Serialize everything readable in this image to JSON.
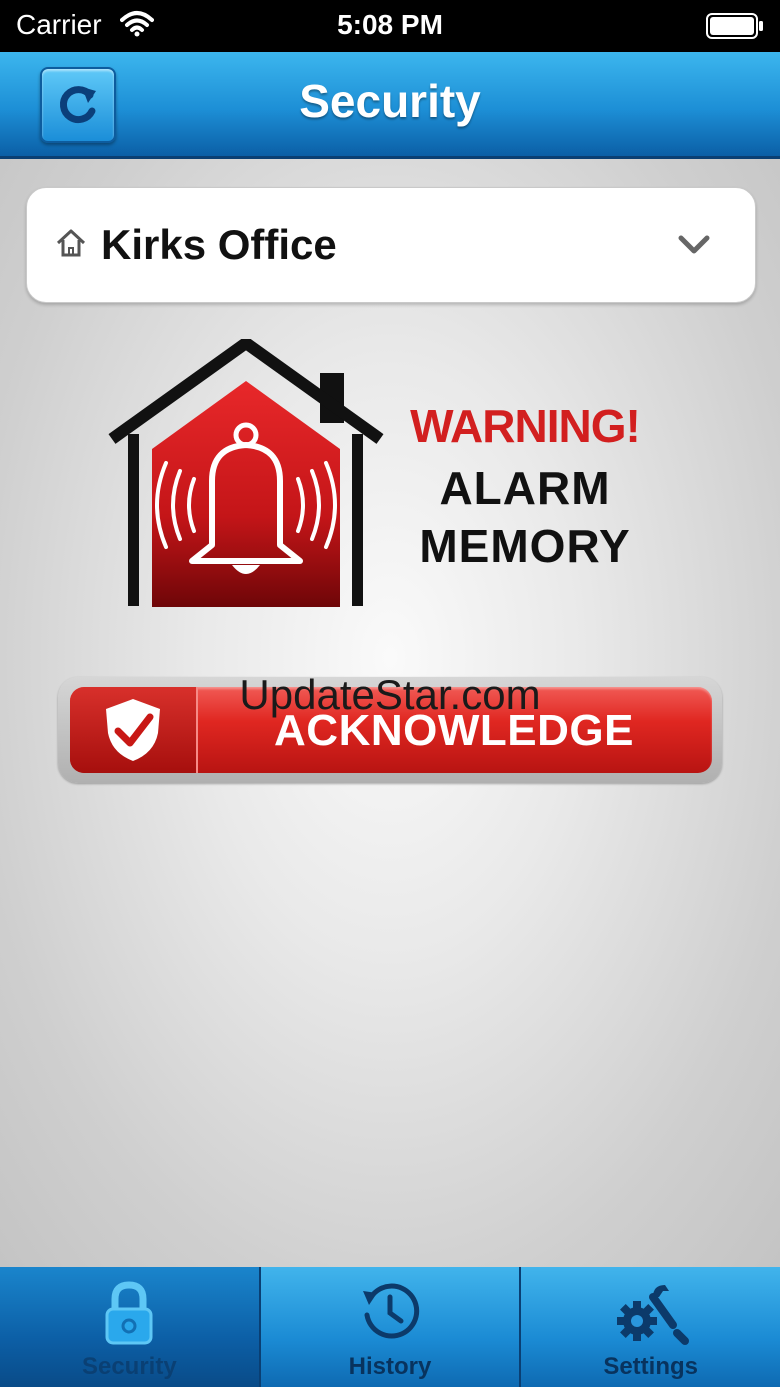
{
  "status_bar": {
    "carrier": "Carrier",
    "time": "5:08 PM"
  },
  "nav": {
    "title": "Security",
    "refresh_icon": "refresh-icon"
  },
  "location": {
    "name": "Kirks Office",
    "icon": "home-icon",
    "dropdown_icon": "chevron-down-icon"
  },
  "alert": {
    "warning": "WARNING!",
    "line1": "ALARM",
    "line2": "MEMORY",
    "icon": "alarm-bell-house-icon",
    "warning_color": "#d21f1f"
  },
  "acknowledge": {
    "label": "ACKNOWLEDGE",
    "icon": "shield-check-icon",
    "color": "#e02721"
  },
  "watermark": "UpdateStar.com",
  "tabs": [
    {
      "label": "Security",
      "icon": "lock-icon",
      "active": true
    },
    {
      "label": "History",
      "icon": "clock-history-icon",
      "active": false
    },
    {
      "label": "Settings",
      "icon": "gear-wrench-icon",
      "active": false
    }
  ]
}
